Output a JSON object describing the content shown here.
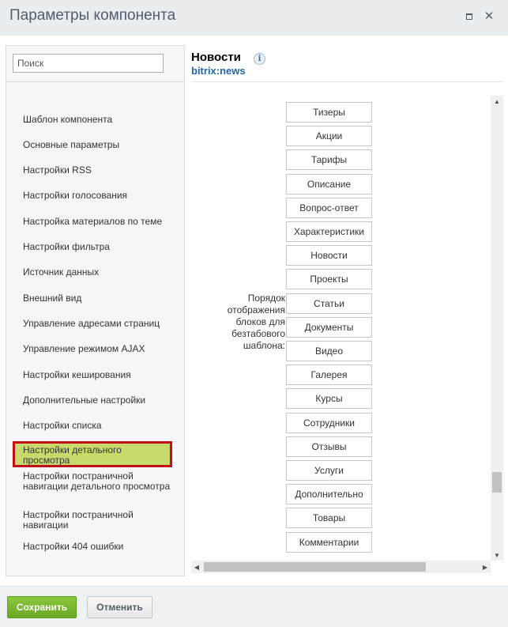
{
  "dialog": {
    "title": "Параметры компонента",
    "maximize_icon": "maximize-icon",
    "close_icon": "close-icon",
    "close_glyph": "✕"
  },
  "search": {
    "placeholder": "Поиск",
    "value": ""
  },
  "sidebar": {
    "items": [
      {
        "label": "Шаблон компонента"
      },
      {
        "label": "Основные параметры"
      },
      {
        "label": "Настройки RSS"
      },
      {
        "label": "Настройки голосования"
      },
      {
        "label": "Настройка материалов по теме"
      },
      {
        "label": "Настройки фильтра"
      },
      {
        "label": "Источник данных"
      },
      {
        "label": "Внешний вид"
      },
      {
        "label": "Управление адресами страниц"
      },
      {
        "label": "Управление режимом AJAX"
      },
      {
        "label": "Настройки кеширования"
      },
      {
        "label": "Дополнительные настройки"
      },
      {
        "label": "Настройки списка"
      },
      {
        "label": "Настройки детального просмотра",
        "active": true
      },
      {
        "label": "Настройки постраничной навигации детального просмотра"
      },
      {
        "label": "Настройки постраничной навигации"
      },
      {
        "label": "Настройки 404 ошибки"
      }
    ]
  },
  "component": {
    "name": "Новости",
    "code": "bitrix:news",
    "info_icon": "info-icon",
    "info_glyph": "i"
  },
  "param": {
    "label": "Порядок отображения блоков для безтабового шаблона:",
    "blocks": [
      "Тизеры",
      "Акции",
      "Тарифы",
      "Описание",
      "Вопрос-ответ",
      "Характеристики",
      "Новости",
      "Проекты",
      "Статьи",
      "Документы",
      "Видео",
      "Галерея",
      "Курсы",
      "Сотрудники",
      "Отзывы",
      "Услуги",
      "Дополнительно",
      "Товары",
      "Комментарии"
    ]
  },
  "scrollbars": {
    "up_glyph": "▲",
    "down_glyph": "▼",
    "left_glyph": "◀",
    "right_glyph": "▶"
  },
  "footer": {
    "save_label": "Сохранить",
    "cancel_label": "Отменить"
  },
  "colors": {
    "save_button": "#7ab72f",
    "active_item_bg": "#c7db6c",
    "active_item_border": "#c20f17",
    "component_code": "#2067b0"
  }
}
